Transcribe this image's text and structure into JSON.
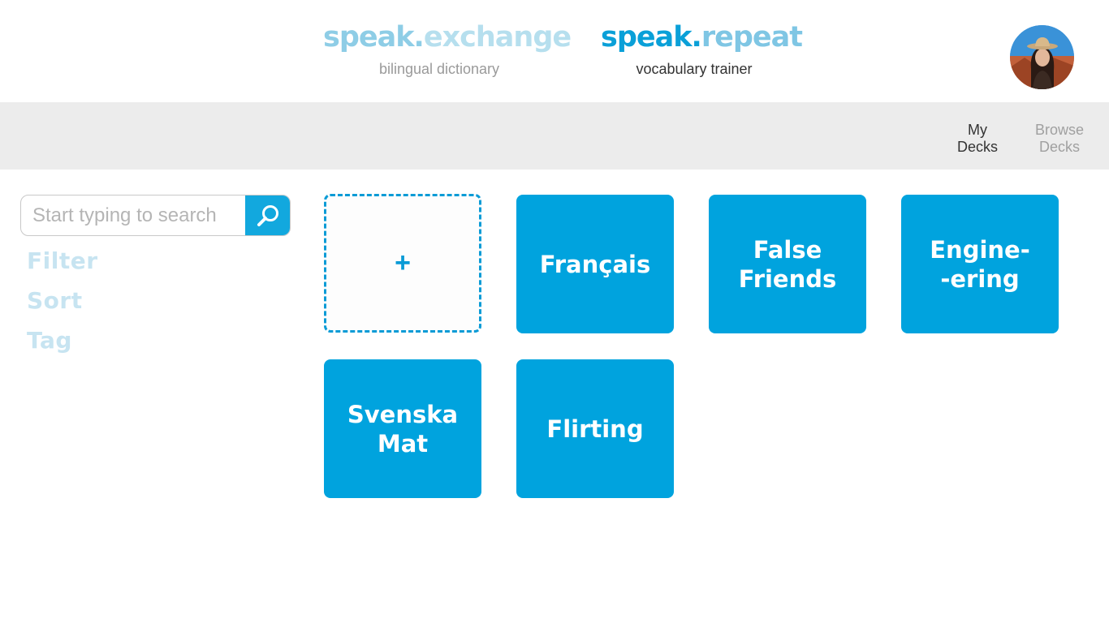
{
  "header": {
    "brands": [
      {
        "name_part1": "speak.",
        "name_part2": "exchange",
        "subtitle": "bilingual dictionary"
      },
      {
        "name_part1": "speak.",
        "name_part2": "repeat",
        "subtitle": "vocabulary trainer"
      }
    ],
    "avatar_icon": "user-avatar-photo"
  },
  "nav": {
    "items": [
      {
        "label": "My\nDecks",
        "active": true
      },
      {
        "label": "Browse\nDecks",
        "active": false
      }
    ]
  },
  "sidebar": {
    "search": {
      "placeholder": "Start typing to search",
      "value": "",
      "icon": "search-icon"
    },
    "links": [
      "Filter",
      "Sort",
      "Tag"
    ]
  },
  "decks": {
    "add_label": "+",
    "items": [
      {
        "label": "Français"
      },
      {
        "label": "False\nFriends"
      },
      {
        "label": "Engine-\n-ering"
      },
      {
        "label": "Svenska\nMat"
      },
      {
        "label": "Flirting"
      }
    ]
  },
  "colors": {
    "accent": "#00a3de",
    "nav_bar": "#ececec",
    "sidebar_link": "#c7e4f1"
  }
}
